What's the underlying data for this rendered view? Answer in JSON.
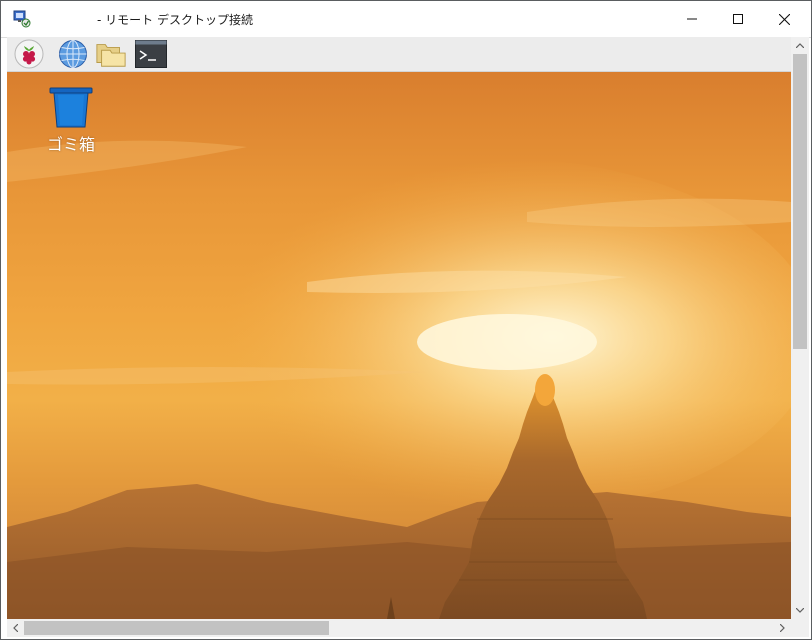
{
  "window": {
    "title": "- リモート デスクトップ接続",
    "app_icon": "remote-desktop-icon",
    "controls": [
      "minimize-icon",
      "maximize-icon",
      "close-icon"
    ]
  },
  "panel": {
    "launchers": [
      {
        "name": "raspberry-pi-menu",
        "icon": "raspberry-pi-icon"
      },
      {
        "name": "web-browser",
        "icon": "globe-icon"
      },
      {
        "name": "file-manager",
        "icon": "folder-icon"
      },
      {
        "name": "terminal",
        "icon": "terminal-icon"
      }
    ]
  },
  "desktop": {
    "icons": [
      {
        "label": "ゴミ箱",
        "icon": "trash-icon"
      }
    ],
    "wallpaper": "pagoda-sunset"
  },
  "scrollbars": {
    "vertical_position": 0.0,
    "horizontal_position": 0.0
  },
  "colors": {
    "sky_top": "#d97e2e",
    "sky_mid": "#f0a640",
    "sun": "#fff3c8",
    "hills": "#a2622c",
    "pagoda": "#8a5527",
    "trash_blue": "#1565c0"
  }
}
